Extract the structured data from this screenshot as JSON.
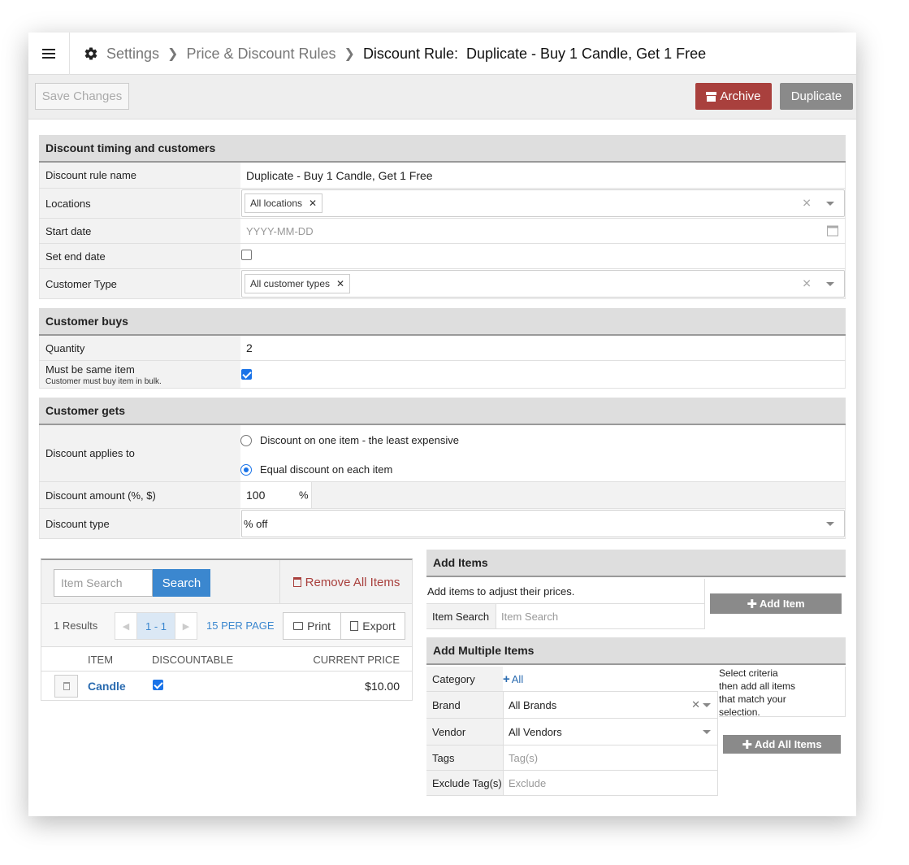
{
  "breadcrumb": {
    "items": [
      "Settings",
      "Price & Discount Rules"
    ],
    "current": "Discount Rule:  Duplicate - Buy 1 Candle, Get 1 Free"
  },
  "toolbar": {
    "save_label": "Save Changes",
    "archive_label": "Archive",
    "duplicate_label": "Duplicate"
  },
  "colors": {
    "archive": "#a9403d",
    "primary": "#3b87cf",
    "link": "#2a6bb0"
  },
  "timing": {
    "title": "Discount timing and customers",
    "name_label": "Discount rule name",
    "name_value": "Duplicate - Buy 1 Candle, Get 1 Free",
    "locations_label": "Locations",
    "locations_tag": "All locations",
    "start_label": "Start date",
    "start_placeholder": "YYYY-MM-DD",
    "end_label": "Set end date",
    "end_checked": false,
    "customer_type_label": "Customer Type",
    "customer_type_tag": "All customer types"
  },
  "buys": {
    "title": "Customer buys",
    "quantity_label": "Quantity",
    "quantity_value": "2",
    "same_label": "Must be same item",
    "same_note": "Customer must buy item in bulk.",
    "same_checked": true
  },
  "gets": {
    "title": "Customer gets",
    "applies_label": "Discount applies to",
    "options": [
      "Discount on one item - the least expensive",
      "Equal discount on each item"
    ],
    "selected_option": "Equal discount on each item",
    "amount_label": "Discount amount (%, $)",
    "amount_value": "100",
    "amount_unit": "%",
    "type_label": "Discount type",
    "type_value": "% off"
  },
  "item_list": {
    "search_placeholder": "Item Search",
    "search_label": "Search",
    "remove_all_label": "Remove All Items",
    "results": "1 Results",
    "page": "1 - 1",
    "per_page": "15 PER PAGE",
    "print_label": "Print",
    "export_label": "Export",
    "columns": [
      "ITEM",
      "DISCOUNTABLE",
      "CURRENT PRICE"
    ],
    "rows": [
      {
        "item": "Candle",
        "discountable": true,
        "price": "$10.00"
      }
    ]
  },
  "add_items": {
    "title": "Add Items",
    "description": "Add items to adjust their prices.",
    "search_label": "Item Search",
    "search_placeholder": "Item Search",
    "button_label": "Add Item"
  },
  "add_multiple": {
    "title": "Add Multiple Items",
    "category_label": "Category",
    "category_value": "All",
    "brand_label": "Brand",
    "brand_value": "All Brands",
    "vendor_label": "Vendor",
    "vendor_value": "All Vendors",
    "tags_label": "Tags",
    "tags_placeholder": "Tag(s)",
    "exclude_label": "Exclude Tag(s)",
    "exclude_placeholder": "Exclude",
    "criteria_text": [
      "Select criteria",
      "then add all items",
      "that match your",
      "selection."
    ],
    "button_label": "Add All Items"
  }
}
